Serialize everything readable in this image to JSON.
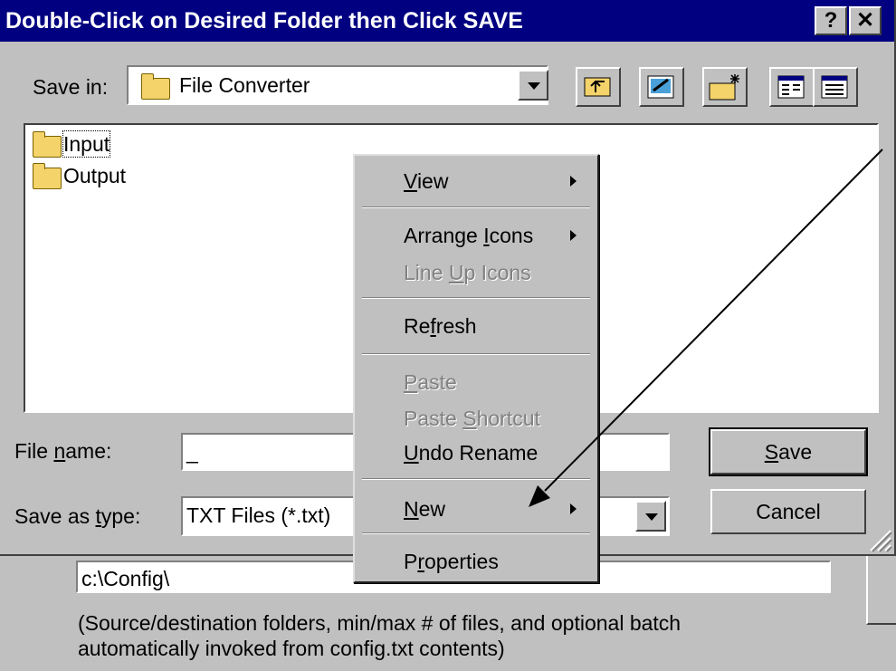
{
  "dialog": {
    "title": "Double-Click on Desired Folder then Click SAVE",
    "help_label": "?",
    "close_label": "✕"
  },
  "toolbar": {
    "save_in_label": "Save in:",
    "current_folder": "File Converter",
    "buttons": [
      "up-one-level-icon",
      "desktop-icon",
      "new-folder-icon",
      "list-view-icon",
      "details-view-icon"
    ]
  },
  "files": [
    {
      "name": "Input",
      "icon": "folder-icon",
      "focused": true
    },
    {
      "name": "Output",
      "icon": "folder-icon",
      "focused": false
    }
  ],
  "filename": {
    "label": "File name:",
    "value": "_"
  },
  "filetype": {
    "label": "Save as type:",
    "value": "TXT Files (*.txt)"
  },
  "buttons": {
    "save": "Save",
    "cancel": "Cancel"
  },
  "context_menu": {
    "items": [
      {
        "label": "View",
        "submenu": true,
        "enabled": true
      },
      {
        "label": "Arrange Icons",
        "submenu": true,
        "enabled": true
      },
      {
        "label": "Line Up Icons",
        "submenu": false,
        "enabled": false
      },
      {
        "label": "Refresh",
        "submenu": false,
        "enabled": true
      },
      {
        "label": "Paste",
        "submenu": false,
        "enabled": false
      },
      {
        "label": "Paste Shortcut",
        "submenu": false,
        "enabled": false
      },
      {
        "label": "Undo Rename",
        "submenu": false,
        "enabled": true
      },
      {
        "label": "New",
        "submenu": true,
        "enabled": true
      },
      {
        "label": "Properties",
        "submenu": false,
        "enabled": true
      }
    ]
  },
  "background": {
    "path": "c:\\Config\\",
    "note_line1": "(Source/destination folders, min/max # of files, and optional batch",
    "note_line2": "automatically invoked from config.txt contents)"
  },
  "colors": {
    "title_bar": "#000080",
    "face": "#c0c0c0"
  }
}
